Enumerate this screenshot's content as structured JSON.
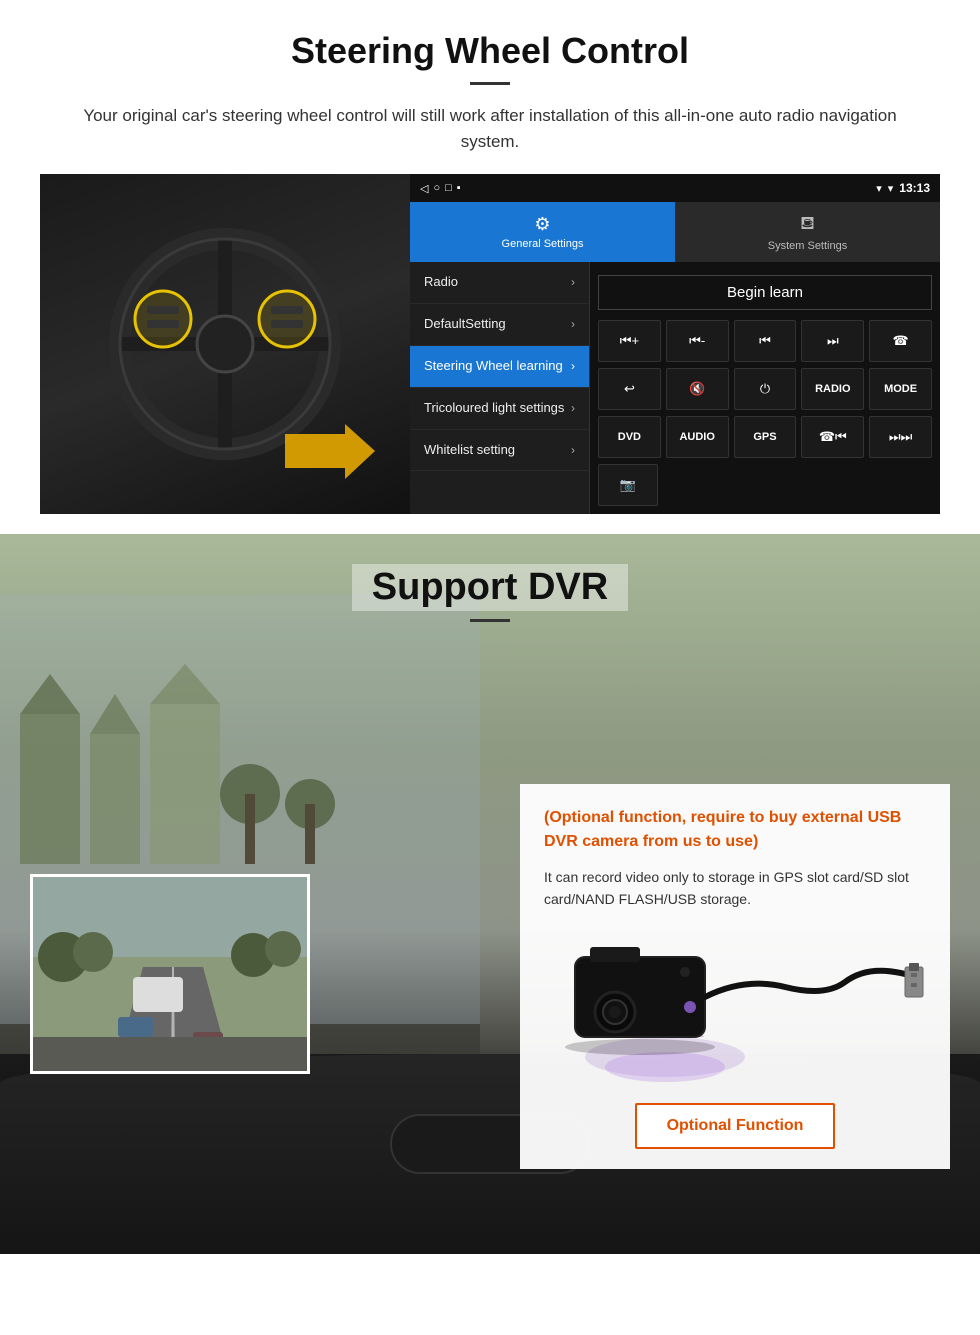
{
  "steering": {
    "title": "Steering Wheel Control",
    "subtitle": "Your original car's steering wheel control will still work after installation of this all-in-one auto radio navigation system.",
    "statusbar": {
      "time": "13:13",
      "nav_icons": "◁  ○  □  ■"
    },
    "tabs": [
      {
        "label": "General Settings",
        "icon": "⚙",
        "active": true
      },
      {
        "label": "System Settings",
        "icon": "⛾",
        "active": false
      }
    ],
    "menu_items": [
      {
        "label": "Radio",
        "active": false
      },
      {
        "label": "DefaultSetting",
        "active": false
      },
      {
        "label": "Steering Wheel learning",
        "active": true
      },
      {
        "label": "Tricoloured light settings",
        "active": false
      },
      {
        "label": "Whitelist setting",
        "active": false
      }
    ],
    "begin_learn": "Begin learn",
    "control_buttons_row1": [
      "vol+",
      "vol-",
      "⏮",
      "⏭",
      "☎"
    ],
    "control_buttons_row2": [
      "↩",
      "🔇",
      "⏻",
      "RADIO",
      "MODE"
    ],
    "control_buttons_row3": [
      "DVD",
      "AUDIO",
      "GPS",
      "☎⏮",
      "⏭⏭"
    ],
    "control_buttons_row4": [
      "📷"
    ]
  },
  "dvr": {
    "title": "Support DVR",
    "optional_text": "(Optional function, require to buy external USB DVR camera from us to use)",
    "description": "It can record video only to storage in GPS slot card/SD slot card/NAND FLASH/USB storage.",
    "optional_button_label": "Optional Function"
  }
}
